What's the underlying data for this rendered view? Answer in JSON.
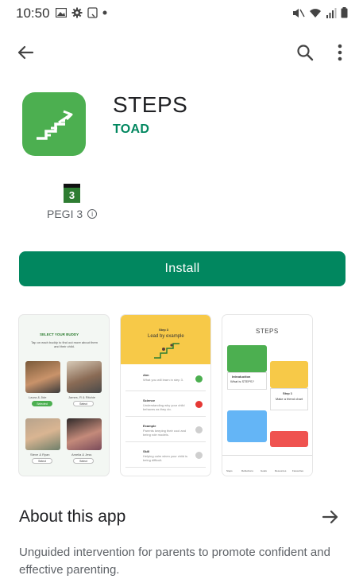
{
  "status_bar": {
    "time": "10:50"
  },
  "app": {
    "name": "STEPS",
    "developer": "TOAD",
    "icon_color": "#4caf50",
    "rating_badge": "3",
    "rating_label": "PEGI 3",
    "install_label": "Install",
    "accent": "#01875f"
  },
  "screenshots": {
    "s1": {
      "title": "SELECT YOUR BUDDY",
      "subtitle": "Tap on each buddy to find out more about them and their child.",
      "buddies": [
        {
          "name": "Laura & Jide",
          "button": "Selected"
        },
        {
          "name": "James, R & Ritchie",
          "button": "Select"
        },
        {
          "name": "Steve & Ryan",
          "button": "Select"
        },
        {
          "name": "Amelia & Jess",
          "button": "Select"
        }
      ]
    },
    "s2": {
      "step": "Step 3",
      "title": "Lead by example",
      "rows": [
        {
          "name": "Aim",
          "desc": "What you will learn in step 3."
        },
        {
          "name": "Science",
          "desc": "Understanding why your child behaves as they do."
        },
        {
          "name": "Example",
          "desc": "Parents keeping their cool and being role models."
        },
        {
          "name": "Skill",
          "desc": "Helping calm when your child is being difficult."
        }
      ]
    },
    "s3": {
      "logo": "STEPS",
      "card1_title": "Introduction",
      "card1_sub": "What is STEPS?",
      "card2_title": "Step 1",
      "card2_sub": "Make a friend chart",
      "nav": [
        "Steps",
        "Reflections",
        "Goals",
        "Resources",
        "Favourites"
      ]
    }
  },
  "about": {
    "title": "About this app",
    "description": "Unguided intervention for parents to promote confident and effective parenting."
  }
}
